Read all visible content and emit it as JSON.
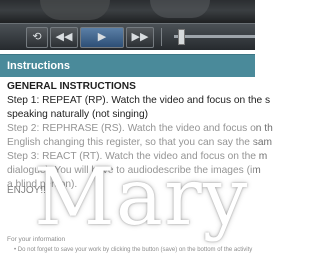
{
  "player": {
    "reload_icon": "reload-icon",
    "rewind_icon": "rewind-icon",
    "play_icon": "play-icon",
    "fastforward_icon": "fast-forward-icon",
    "glyph_reload": "⟲",
    "glyph_rewind": "◀◀",
    "glyph_play": "▶",
    "glyph_ff": "▶▶"
  },
  "panel": {
    "title": "Instructions"
  },
  "instructions": {
    "heading": "GENERAL INSTRUCTIONS",
    "step1_a": "Step 1: REPEAT (RP). Watch the video and focus on the s",
    "step1_b": "speaking naturally (not singing)",
    "step2_a": "Step 2: REPHRASE (RS). Watch the video and focus on th",
    "step2_b": "English changing this register, so that you can say the sam",
    "step3_a": "Step 3: REACT (RT). Watch the video and focus on the m",
    "step3_b": "dialogue). You will have to audiodescribe the images (im",
    "step3_c": "a blind person).",
    "enjoy": "ENJOY!!",
    "note_label": "For your information",
    "note_text": "Do not forget to save your work by clicking the button (save) on the bottom of the activity"
  },
  "watermark": "Mary"
}
